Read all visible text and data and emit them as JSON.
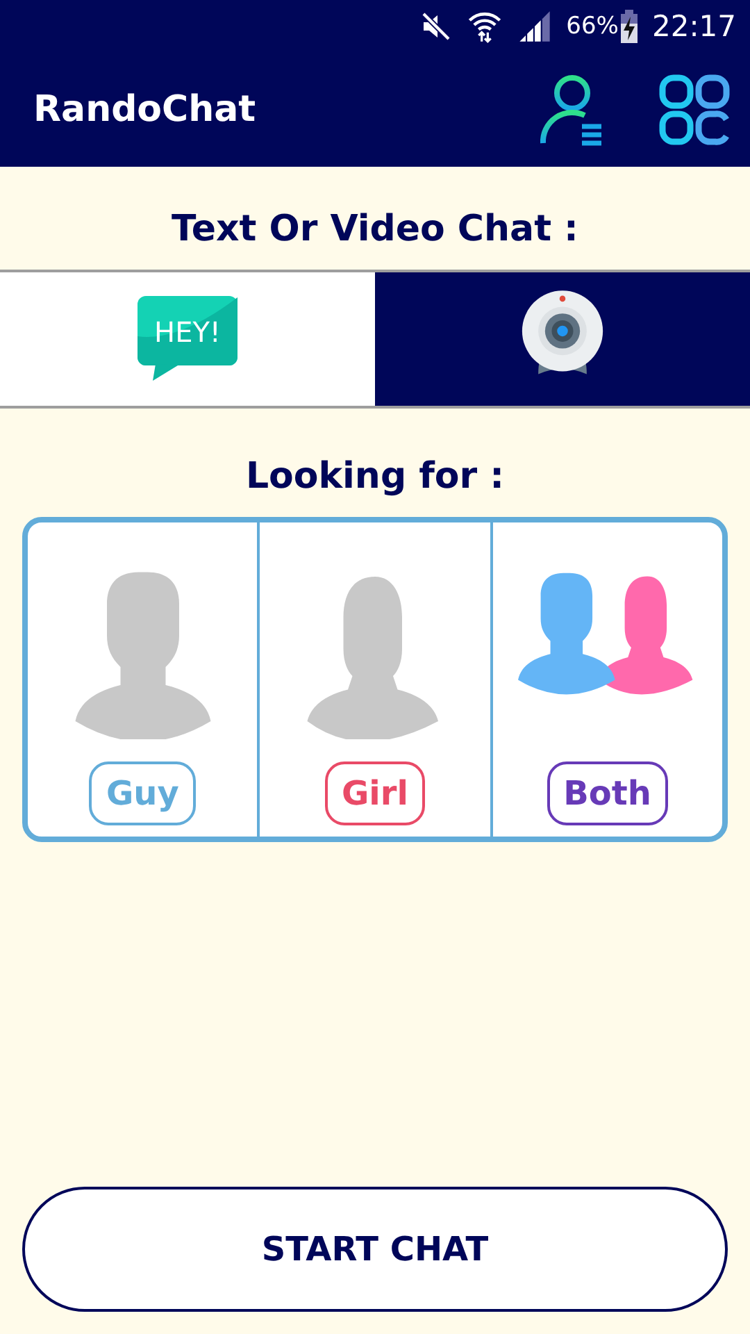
{
  "status_bar": {
    "battery": "66%",
    "time": "22:17"
  },
  "app_bar": {
    "title": "RandoChat"
  },
  "chat_type": {
    "heading": "Text Or Video Chat :",
    "options": [
      {
        "kind": "text",
        "icon_text": "HEY!",
        "selected": false
      },
      {
        "kind": "video",
        "selected": true
      }
    ]
  },
  "looking_for": {
    "heading": "Looking for :",
    "options": [
      {
        "kind": "guy",
        "label": "Guy",
        "color": "#62acd9"
      },
      {
        "kind": "girl",
        "label": "Girl",
        "color": "#e94a67"
      },
      {
        "kind": "both",
        "label": "Both",
        "color": "#673ab7"
      }
    ]
  },
  "start_button": {
    "label": "START CHAT"
  }
}
